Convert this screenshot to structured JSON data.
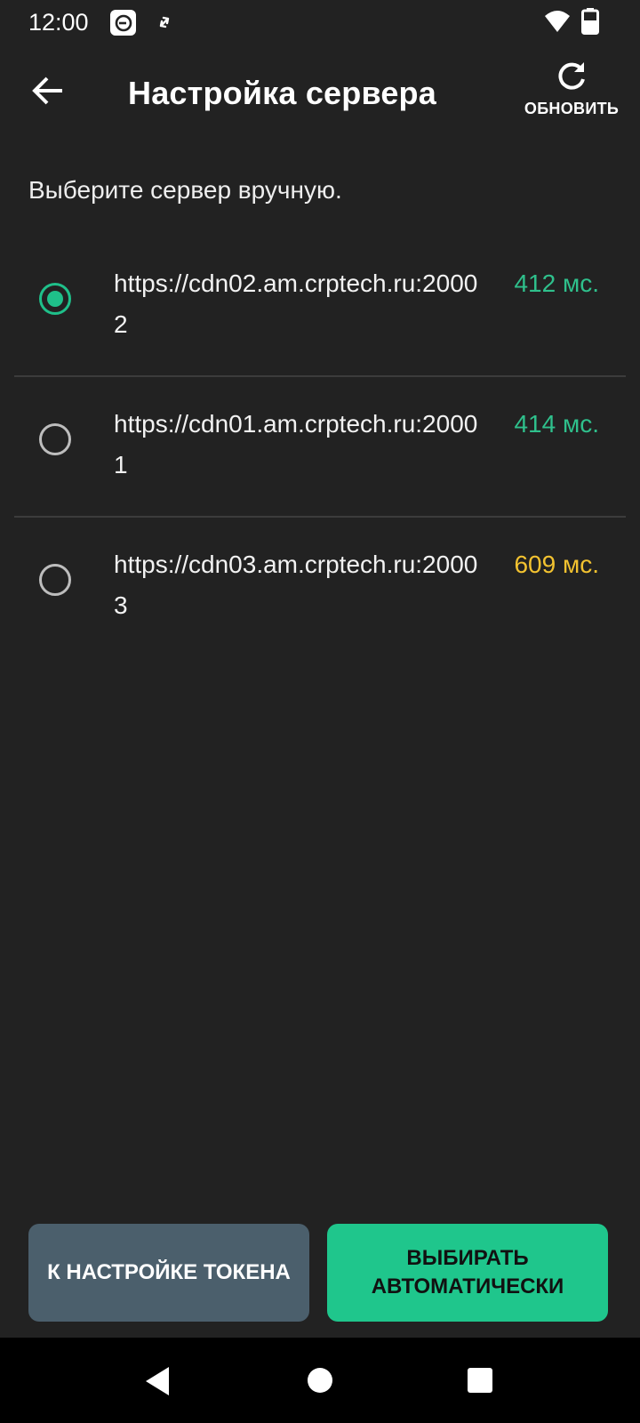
{
  "status_bar": {
    "time": "12:00",
    "icons": [
      "app-notification-icon",
      "sync-icon",
      "wifi-icon",
      "battery-icon"
    ]
  },
  "app_bar": {
    "title": "Настройка сервера",
    "back_icon": "arrow-left-icon",
    "refresh_icon": "refresh-icon",
    "refresh_label": "ОБНОВИТЬ"
  },
  "hint": "Выберите сервер вручную.",
  "servers": [
    {
      "url": "https://cdn02.am.crptech.ru:20002",
      "latency": "412 мс.",
      "latency_color": "#2fc08c",
      "selected": true
    },
    {
      "url": "https://cdn01.am.crptech.ru:20001",
      "latency": "414 мс.",
      "latency_color": "#2fc08c",
      "selected": false
    },
    {
      "url": "https://cdn03.am.crptech.ru:20003",
      "latency": "609 мс.",
      "latency_color": "#f2c230",
      "selected": false
    }
  ],
  "buttons": {
    "token_label": "К НАСТРОЙКЕ ТОКЕНА",
    "auto_label": "ВЫБИРАТЬ АВТОМАТИЧЕСКИ"
  },
  "colors": {
    "background": "#222222",
    "accent": "#1fc68c",
    "secondary_button": "#4b5f6c"
  },
  "nav_bar": {
    "icons": [
      "nav-back-icon",
      "nav-home-icon",
      "nav-recents-icon"
    ]
  }
}
